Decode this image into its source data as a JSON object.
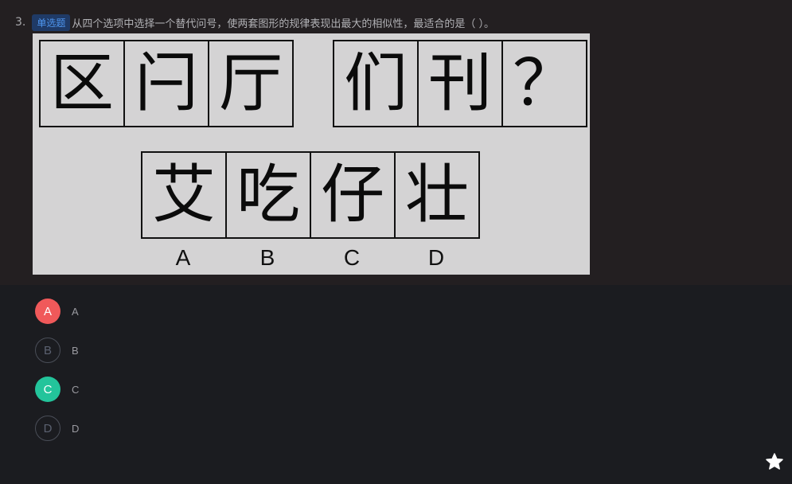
{
  "question": {
    "number": "3.",
    "type_badge": "单选题",
    "text": "从四个选项中选择一个替代问号，使两套图形的规律表现出最大的相似性，最适合的是（   ）。"
  },
  "figure": {
    "set1": [
      "区",
      "闩",
      "厅"
    ],
    "set2": [
      "们",
      "刊",
      "？"
    ],
    "options": [
      "艾",
      "吃",
      "仔",
      "壮"
    ],
    "option_letters": [
      "A",
      "B",
      "C",
      "D"
    ]
  },
  "answers": [
    {
      "letter": "A",
      "label": "A",
      "state": "wrong"
    },
    {
      "letter": "B",
      "label": "B",
      "state": "normal"
    },
    {
      "letter": "C",
      "label": "C",
      "state": "correct"
    },
    {
      "letter": "D",
      "label": "D",
      "state": "normal"
    }
  ],
  "colors": {
    "wrong": "#f0595a",
    "correct": "#23c49b",
    "badge_bg": "#1f3a66",
    "badge_text": "#4f97f0"
  },
  "icons": {
    "favorite": "star-icon"
  }
}
